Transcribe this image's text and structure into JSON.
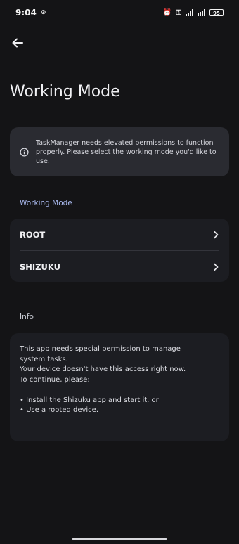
{
  "status_bar": {
    "time": "9:04",
    "battery": "95"
  },
  "header": {
    "title": "Working Mode"
  },
  "notice": {
    "text": "TaskManager needs elevated permissions to function properly. Please select the working mode you'd like to use."
  },
  "working_mode": {
    "label": "Working Mode",
    "options": [
      {
        "label": "ROOT"
      },
      {
        "label": "SHIZUKU"
      }
    ]
  },
  "info": {
    "label": "Info",
    "lines": [
      "This app needs special permission to manage",
      "system tasks.",
      "Your device doesn't have this access right now.",
      "To continue, please:",
      "",
      "• Install the Shizuku app and start it, or",
      "• Use a rooted device."
    ]
  },
  "icons": {
    "back": "back-arrow-icon",
    "info": "info-icon",
    "chevron": "chevron-right-icon"
  }
}
